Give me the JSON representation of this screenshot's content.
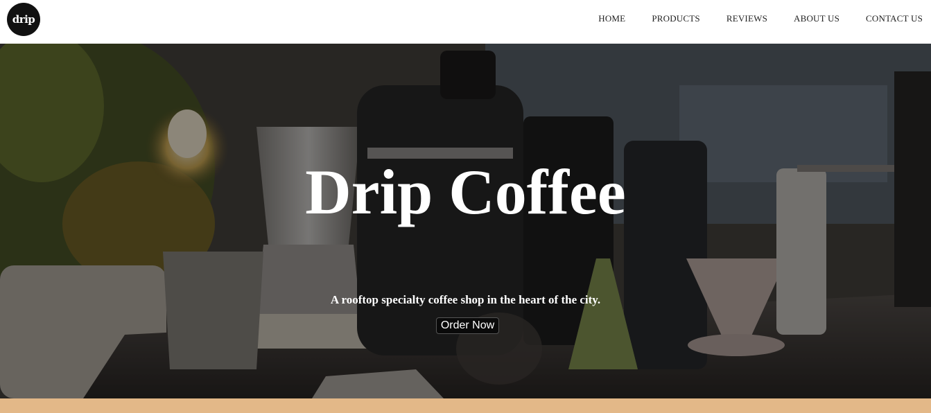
{
  "nav": {
    "logo_text": "drip",
    "links": [
      "HOME",
      "PRODUCTS",
      "REVIEWS",
      "ABOUT US",
      "CONTACT US"
    ]
  },
  "hero": {
    "title": "Drip Coffee",
    "subtitle": "A rooftop specialty coffee shop in the heart of the city.",
    "cta_label": "Order Now"
  },
  "colors": {
    "nav_background": "#ffffff",
    "logo_background": "#111111",
    "hero_overlay": "#000000",
    "cta_background": "#0a0a0a",
    "footer_band": "#e3b888"
  }
}
